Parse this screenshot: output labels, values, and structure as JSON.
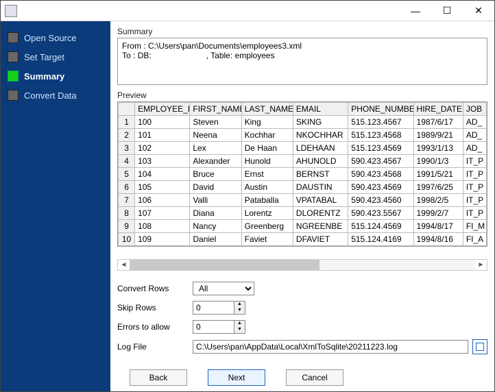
{
  "window": {
    "min": "—",
    "max": "☐",
    "close": "✕"
  },
  "nav": {
    "items": [
      {
        "label": "Open Source"
      },
      {
        "label": "Set Target"
      },
      {
        "label": "Summary"
      },
      {
        "label": "Convert Data"
      }
    ]
  },
  "summary": {
    "title": "Summary",
    "from_label": "From : ",
    "from_value": "C:\\Users\\pan\\Documents\\employees3.xml",
    "to_label": "To : ",
    "to_db": "DB:",
    "to_table_label": ", Table: ",
    "to_table": "employees"
  },
  "preview": {
    "title": "Preview",
    "cols": [
      "EMPLOYEE_ID",
      "FIRST_NAME",
      "LAST_NAME",
      "EMAIL",
      "PHONE_NUMBER",
      "HIRE_DATE",
      "JOB"
    ],
    "rows": [
      {
        "n": "1",
        "c": [
          "100",
          "Steven",
          "King",
          "SKING",
          "515.123.4567",
          "1987/6/17",
          "AD_"
        ]
      },
      {
        "n": "2",
        "c": [
          "101",
          "Neena",
          "Kochhar",
          "NKOCHHAR",
          "515.123.4568",
          "1989/9/21",
          "AD_"
        ]
      },
      {
        "n": "3",
        "c": [
          "102",
          "Lex",
          "De Haan",
          "LDEHAAN",
          "515.123.4569",
          "1993/1/13",
          "AD_"
        ]
      },
      {
        "n": "4",
        "c": [
          "103",
          "Alexander",
          "Hunold",
          "AHUNOLD",
          "590.423.4567",
          "1990/1/3",
          "IT_P"
        ]
      },
      {
        "n": "5",
        "c": [
          "104",
          "Bruce",
          "Ernst",
          "BERNST",
          "590.423.4568",
          "1991/5/21",
          "IT_P"
        ]
      },
      {
        "n": "6",
        "c": [
          "105",
          "David",
          "Austin",
          "DAUSTIN",
          "590.423.4569",
          "1997/6/25",
          "IT_P"
        ]
      },
      {
        "n": "7",
        "c": [
          "106",
          "Valli",
          "Pataballa",
          "VPATABAL",
          "590.423.4560",
          "1998/2/5",
          "IT_P"
        ]
      },
      {
        "n": "8",
        "c": [
          "107",
          "Diana",
          "Lorentz",
          "DLORENTZ",
          "590.423.5567",
          "1999/2/7",
          "IT_P"
        ]
      },
      {
        "n": "9",
        "c": [
          "108",
          "Nancy",
          "Greenberg",
          "NGREENBE",
          "515.124.4569",
          "1994/8/17",
          "FI_M"
        ]
      },
      {
        "n": "10",
        "c": [
          "109",
          "Daniel",
          "Faviet",
          "DFAVIET",
          "515.124.4169",
          "1994/8/16",
          "FI_A"
        ]
      }
    ]
  },
  "form": {
    "convert_rows": {
      "label": "Convert Rows",
      "value": "All"
    },
    "skip_rows": {
      "label": "Skip Rows",
      "value": "0"
    },
    "errors": {
      "label": "Errors to allow",
      "value": "0"
    },
    "log_file": {
      "label": "Log File",
      "value": "C:\\Users\\pan\\AppData\\Local\\XmlToSqlite\\20211223.log"
    }
  },
  "buttons": {
    "back": "Back",
    "next": "Next",
    "cancel": "Cancel"
  }
}
